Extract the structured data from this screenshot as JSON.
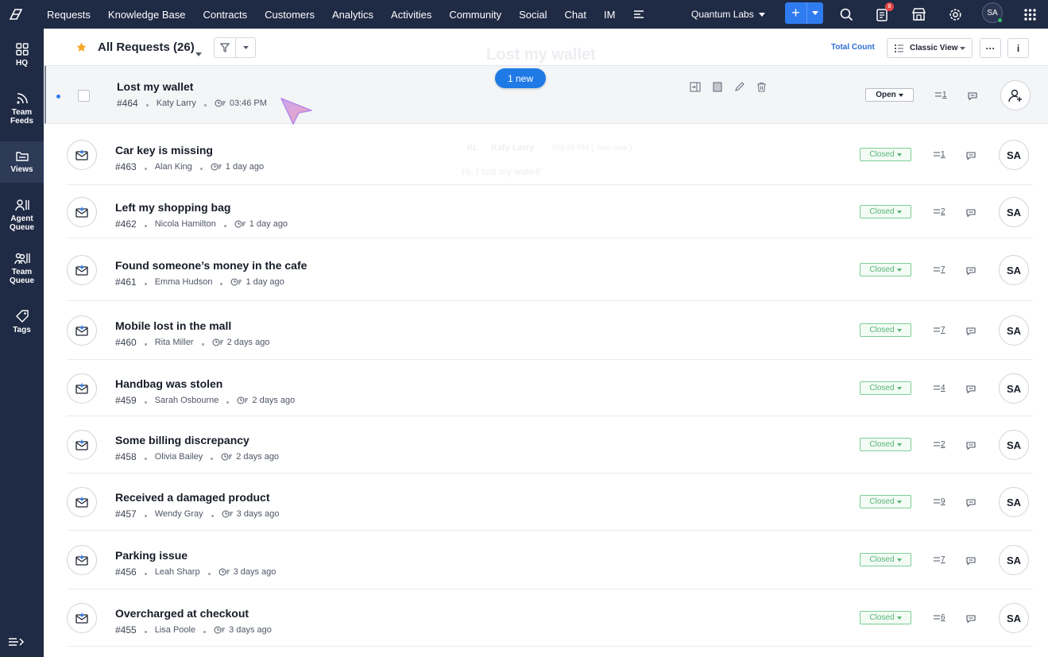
{
  "topnav": {
    "items": [
      "Requests",
      "Knowledge Base",
      "Contracts",
      "Customers",
      "Analytics",
      "Activities",
      "Community",
      "Social",
      "Chat",
      "IM"
    ],
    "org": "Quantum Labs",
    "notification_count": "8",
    "avatar": "SA"
  },
  "sidebar": {
    "items": [
      {
        "label": "HQ"
      },
      {
        "label": "Team Feeds"
      },
      {
        "label": "Views"
      },
      {
        "label": "Agent Queue"
      },
      {
        "label": "Team Queue"
      },
      {
        "label": "Tags"
      }
    ]
  },
  "toolbar": {
    "title": "All Requests (26)",
    "total_count": "Total Count",
    "view": "Classic View",
    "more": "···",
    "info": "i"
  },
  "new_pill": "1 new",
  "ghost": {
    "subject": "Lost my wallet",
    "agent_initials": "KL",
    "agent_name": "Katy Larry",
    "time": "(03:46 PM ( Just now )",
    "message": "Hi, I lost my wallet!"
  },
  "tickets": [
    {
      "title": "Lost my wallet",
      "id": "#464",
      "contact": "Katy Larry",
      "time": "03:46 PM",
      "status": "Open",
      "threads": "1",
      "owner": ""
    },
    {
      "title": "Car key is missing",
      "id": "#463",
      "contact": "Alan King",
      "time": "1 day ago",
      "status": "Closed",
      "threads": "1",
      "owner": "SA"
    },
    {
      "title": "Left my shopping bag",
      "id": "#462",
      "contact": "Nicola Hamilton",
      "time": "1 day ago",
      "status": "Closed",
      "threads": "2",
      "owner": "SA"
    },
    {
      "title": "Found someone’s money in the cafe",
      "id": "#461",
      "contact": "Emma Hudson",
      "time": "1 day ago",
      "status": "Closed",
      "threads": "7",
      "owner": "SA"
    },
    {
      "title": "Mobile lost in the mall",
      "id": "#460",
      "contact": "Rita Miller",
      "time": "2 days ago",
      "status": "Closed",
      "threads": "7",
      "owner": "SA"
    },
    {
      "title": "Handbag was stolen",
      "id": "#459",
      "contact": "Sarah Osbourne",
      "time": "2 days ago",
      "status": "Closed",
      "threads": "4",
      "owner": "SA"
    },
    {
      "title": "Some billing discrepancy",
      "id": "#458",
      "contact": "Olivia Bailey",
      "time": "2 days ago",
      "status": "Closed",
      "threads": "2",
      "owner": "SA"
    },
    {
      "title": "Received a damaged product",
      "id": "#457",
      "contact": "Wendy Gray",
      "time": "3 days ago",
      "status": "Closed",
      "threads": "9",
      "owner": "SA"
    },
    {
      "title": "Parking issue",
      "id": "#456",
      "contact": "Leah Sharp",
      "time": "3 days ago",
      "status": "Closed",
      "threads": "7",
      "owner": "SA"
    },
    {
      "title": "Overcharged at checkout",
      "id": "#455",
      "contact": "Lisa Poole",
      "time": "3 days ago",
      "status": "Closed",
      "threads": "6",
      "owner": "SA"
    }
  ]
}
